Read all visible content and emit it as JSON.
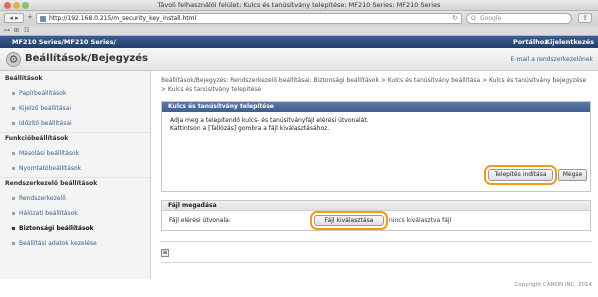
{
  "window": {
    "title": "Távoli felhasználói felület: Kulcs és tanúsítvány telepítése: MF210 Series: MF210 Series"
  },
  "browser": {
    "url": "http://192.168.0.215/m_security_key_install.html",
    "search_placeholder": "Google",
    "back_label": "◂ ▸",
    "plus_label": "+"
  },
  "app": {
    "model": "MF210 Series/MF210 Series/",
    "portal_label": "Portálhoz",
    "logout_label": "Kijelentkezés",
    "page_title": "Beállítások/Bejegyzés",
    "email_link": "E-mail a rendszerkezelőnek"
  },
  "sidebar": {
    "sections": [
      {
        "heading": "Beállítások",
        "items": [
          "Papírbeállítások",
          "Kijelző beállításai",
          "Időzítő beállításai"
        ]
      },
      {
        "heading": "Funkcióbeállítások",
        "items": [
          "Másolási beállítások",
          "Nyomtatóbeállítások"
        ]
      },
      {
        "heading": "Rendszerkezelő beállítások",
        "items": [
          "Rendszerkezelő",
          "Hálózati beállítások",
          "Biztonsági beállítások",
          "Beállítási adatok kezelése"
        ]
      }
    ],
    "active_item": "Biztonsági beállítások"
  },
  "main": {
    "breadcrumb": "Beállítások/Bejegyzés: Rendszerkezelő beállításai: Biztonsági beállítások > Kulcs és tanúsítvány beállítása > Kulcs és tanúsítvány bejegyzése > Kulcs és tanúsítvány telepítése",
    "panel1": {
      "title": "Kulcs és tanúsítvány telepítése",
      "line1": "Adja meg a telepítendő kulcs- és tanúsítványfájl elérési útvonalát.",
      "line2": "Kattintson a [Tallózás] gombra a fájl kiválasztásához.",
      "install_button": "Telepítés indítása",
      "cancel_button": "Mégse"
    },
    "panel2": {
      "title": "Fájl megadása",
      "field_label": "Fájl elérési útvonala:",
      "choose_button": "Fájl kiválasztása",
      "no_file_text": "nincs kiválasztva fájl"
    },
    "collapse_label": "≡"
  },
  "footer": {
    "copyright": "Copyright CANON INC. 2014"
  },
  "colors": {
    "header_blue": "#2c4a77",
    "highlight_orange": "#f39a12",
    "link_blue": "#3a5d8e"
  },
  "icons": [
    "gear-icon",
    "search-icon",
    "reload-icon",
    "share-icon",
    "collapse-icon"
  ]
}
